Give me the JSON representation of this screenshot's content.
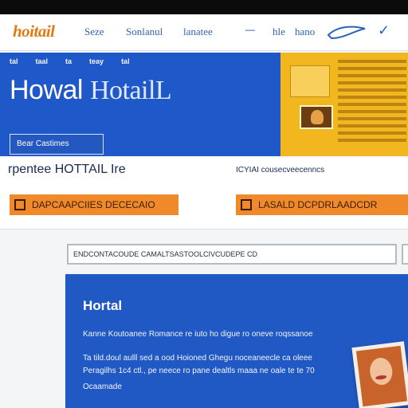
{
  "nav": {
    "logo": "hoitail",
    "links": [
      "Seze",
      "Sonlanul",
      "lanatee",
      "hle",
      "hano"
    ]
  },
  "hero": {
    "menu": [
      "tal",
      "taal",
      "ta",
      "teay",
      "tal"
    ],
    "title_plain": "Howal",
    "title_serif": "HotailL",
    "button_label": "Bear Castimes"
  },
  "promo": {
    "title": "rpentee HOTTAIL Ire",
    "subtitle": "ICYIAI cousecveecenncs",
    "button1_label": "DAPCAAPCIIES DECECAIO",
    "button2_label": "LASALD DCPDRLAADCDR"
  },
  "search": {
    "value": "ENDCONTACOUDE CAMALTSASTOOLCIVCUDEPE CD"
  },
  "card": {
    "title": "Hortal",
    "line1": "Kanne Koutoanee Romance re iuto ho digue ro oneve roqssanoe",
    "line2": "Ta tild.doul aulll sed a ood Hoioned Ghegu noceaneecle ca oleee",
    "line3": "Peragilhs 1c4 ctl., pe neece ro pane dealtls maaa ne oale te te 70",
    "line4": "Ocaamade"
  },
  "colors": {
    "hero_blue": "#1f58c8",
    "ad_yellow": "#f2b61f",
    "promo_orange": "#f0892a",
    "logo_orange": "#e07a12"
  }
}
